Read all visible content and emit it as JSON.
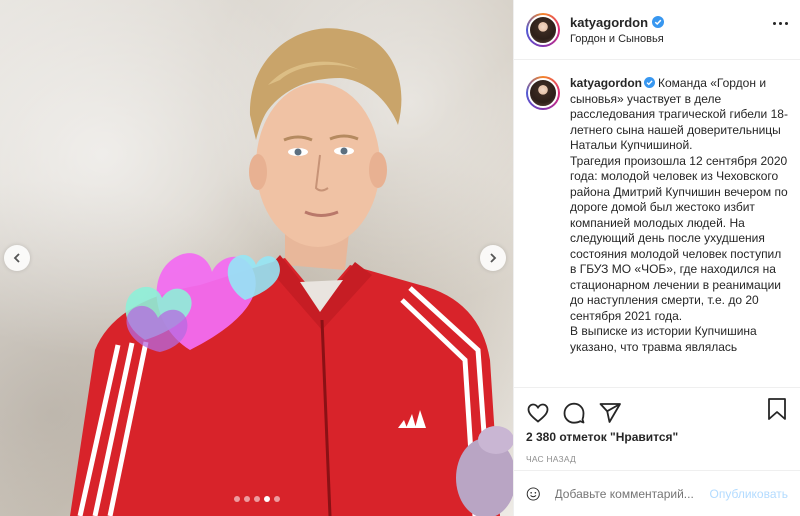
{
  "post": {
    "username": "katyagordon",
    "location": "Гордон и Сыновья",
    "caption_text": "Команда «Гордон и сыновья» участвует в деле расследования трагической гибели 18-летнего сына нашей доверительницы Натальи Купчишиной.",
    "caption_para2": "Трагедия произошла 12 сентября 2020 года: молодой человек из Чеховского района Дмитрий Купчишин вечером по дороге домой был жестоко избит компанией молодых людей. На следующий день после ухудшения состояния молодой человек поступил в ГБУЗ МО «ЧОБ», где находился на стационарном лечении в реанимации до наступления смерти, т.е. до 20 сентября 2021 года.",
    "caption_para3": "В выписке из истории Купчишина указано, что травма являлась",
    "likes": "2 380 отметок \"Нравится\"",
    "time_ago": "ЧАС НАЗАД",
    "comment_placeholder": "Добавьте комментарий...",
    "publish_label": "Опубликовать"
  },
  "media": {
    "carousel_dots": 5,
    "active_dot": 3,
    "shirt_logo": "adidas"
  },
  "icons": {
    "like": "heart-icon",
    "comment": "comment-icon",
    "share": "send-icon",
    "save": "bookmark-icon",
    "emoji": "smiley-icon",
    "verified": "verified-badge-icon"
  },
  "colors": {
    "verified": "#3897f0",
    "publish": "#b3dbff",
    "jacket": "#d8232a"
  }
}
